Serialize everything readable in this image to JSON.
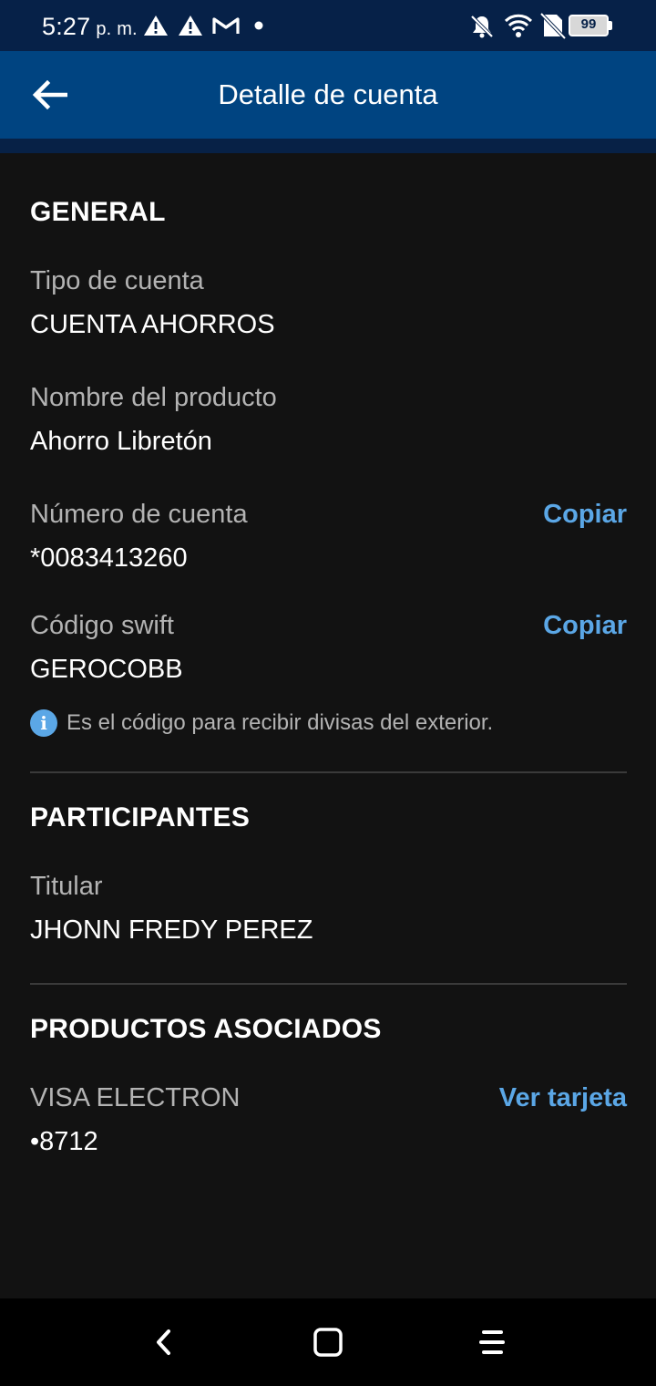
{
  "status_bar": {
    "time": "5:27",
    "ampm": "p. m.",
    "battery": "99",
    "left_icons": [
      "alert-icon",
      "alert-icon",
      "gmail-icon",
      "dot-icon"
    ],
    "right_icons": [
      "bell-off-icon",
      "wifi-icon",
      "no-sim-icon",
      "battery-icon"
    ]
  },
  "header": {
    "title": "Detalle de cuenta",
    "back_icon": "back-arrow-icon",
    "color": "#004481"
  },
  "general": {
    "title": "GENERAL",
    "account_type_label": "Tipo de cuenta",
    "account_type_value": "CUENTA AHORROS",
    "product_name_label": "Nombre del producto",
    "product_name_value": "Ahorro Libretón",
    "account_number_label": "Número de cuenta",
    "account_number_value": "*0083413260",
    "account_number_copy": "Copiar",
    "swift_label": "Código swift",
    "swift_value": "GEROCOBB",
    "swift_copy": "Copiar",
    "swift_info": "Es el código para recibir divisas del exterior."
  },
  "participants": {
    "title": "PARTICIPANTES",
    "holder_label": "Titular",
    "holder_value": "JHONN FREDY PEREZ"
  },
  "associated": {
    "title": "PRODUCTOS ASOCIADOS",
    "card_label": "VISA ELECTRON",
    "card_value": "•8712",
    "card_action": "Ver tarjeta"
  },
  "colors": {
    "background": "#121212",
    "accent": "#5ba7e6",
    "status_bar": "#062148"
  },
  "nav_bar": {
    "icons": [
      "back-nav-icon",
      "home-nav-icon",
      "menu-nav-icon"
    ]
  }
}
